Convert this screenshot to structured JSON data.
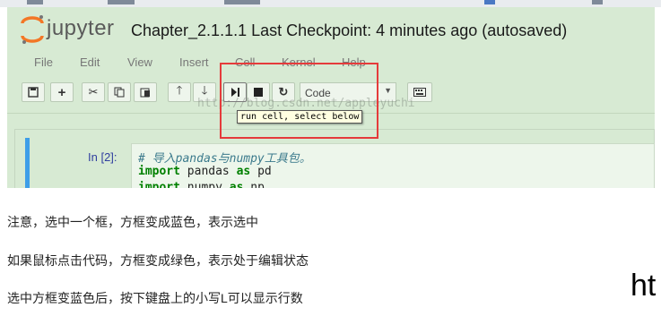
{
  "notebook": {
    "brand": "jupyter",
    "title": "Chapter_2.1.1.1 Last Checkpoint: 4 minutes ago (autosaved)",
    "menu": [
      "File",
      "Edit",
      "View",
      "Insert",
      "Cell",
      "Kernel",
      "Help"
    ],
    "cell_type": "Code",
    "tooltip": "run cell, select below",
    "watermark": "http://blog.csdn.net/appleyuchi",
    "prompt": "In [2]:",
    "code": {
      "comment": "# 导入pandas与numpy工具包。",
      "kw1": "import",
      "mod1": " pandas ",
      "as1": "as",
      "alias1": " pd",
      "kw2": "import",
      "mod2": " numpy ",
      "as2": "as",
      "alias2": " np"
    }
  },
  "notes": [
    "注意，选中一个框，方框变成蓝色，表示选中",
    "如果鼠标点击代码，方框变成绿色，表示处于编辑状态",
    "选中方框变蓝色后，按下键盘上的小写L可以显示行数"
  ],
  "trailing_text": "ht",
  "colors": {
    "notebook_bg": "#d7ead3",
    "highlight_box": "#e53b3b",
    "selected_cell_bar": "#3e9ee8",
    "keyword": "#008000",
    "comment": "#3b7a8c"
  },
  "icons": [
    "save-icon",
    "plus-icon",
    "scissors-icon",
    "copy-icon",
    "paste-icon",
    "arrow-up-icon",
    "arrow-down-icon",
    "run-cell-icon",
    "stop-icon",
    "restart-icon",
    "keyboard-icon"
  ]
}
